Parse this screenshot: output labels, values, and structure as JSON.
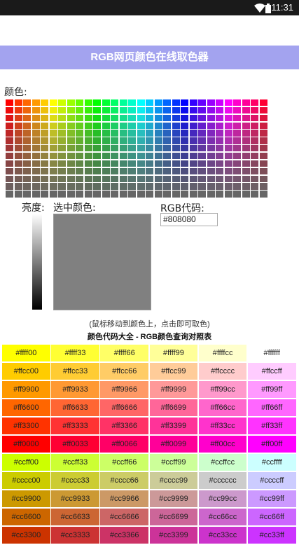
{
  "status": {
    "time": "11:31",
    "wifi_icon": "wifi-icon",
    "battery_icon": "battery-icon"
  },
  "header": {
    "title": "RGB网页颜色在线取色器"
  },
  "picker": {
    "color_label": "颜色:",
    "brightness_label": "亮度:",
    "selected_label": "选中颜色:",
    "rgb_label": "RGB代码:",
    "rgb_value": "#808080",
    "selected_color": "#808080",
    "hint": "(鼠标移动到颜色上，点击即可取色)"
  },
  "table": {
    "title": "颜色代码大全 - RGB颜色查询对照表",
    "rows": [
      [
        "#ffff00",
        "#ffff33",
        "#ffff66",
        "#ffff99",
        "#ffffcc",
        "#ffffff"
      ],
      [
        "#ffcc00",
        "#ffcc33",
        "#ffcc66",
        "#ffcc99",
        "#ffcccc",
        "#ffccff"
      ],
      [
        "#ff9900",
        "#ff9933",
        "#ff9966",
        "#ff9999",
        "#ff99cc",
        "#ff99ff"
      ],
      [
        "#ff6600",
        "#ff6633",
        "#ff6666",
        "#ff6699",
        "#ff66cc",
        "#ff66ff"
      ],
      [
        "#ff3300",
        "#ff3333",
        "#ff3366",
        "#ff3399",
        "#ff33cc",
        "#ff33ff"
      ],
      [
        "#ff0000",
        "#ff0033",
        "#ff0066",
        "#ff0099",
        "#ff00cc",
        "#ff00ff"
      ],
      [
        "#ccff00",
        "#ccff33",
        "#ccff66",
        "#ccff99",
        "#ccffcc",
        "#ccffff"
      ],
      [
        "#cccc00",
        "#cccc33",
        "#cccc66",
        "#cccc99",
        "#cccccc",
        "#ccccff"
      ],
      [
        "#cc9900",
        "#cc9933",
        "#cc9966",
        "#cc9999",
        "#cc99cc",
        "#cc99ff"
      ],
      [
        "#cc6600",
        "#cc6633",
        "#cc6666",
        "#cc6699",
        "#cc66cc",
        "#cc66ff"
      ],
      [
        "#cc3300",
        "#cc3333",
        "#cc3366",
        "#cc3399",
        "#cc33cc",
        "#cc33ff"
      ]
    ]
  }
}
